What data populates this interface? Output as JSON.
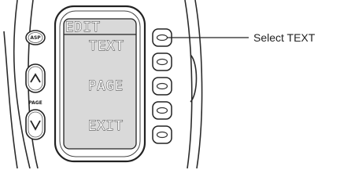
{
  "device": {
    "left_buttons": {
      "top_label": "ASP",
      "page_label": "PAGE"
    },
    "screen": {
      "title": "EDIT",
      "items": [
        "TEXT",
        "PAGE",
        "EXIT"
      ]
    }
  },
  "callout": {
    "text": "Select TEXT"
  }
}
